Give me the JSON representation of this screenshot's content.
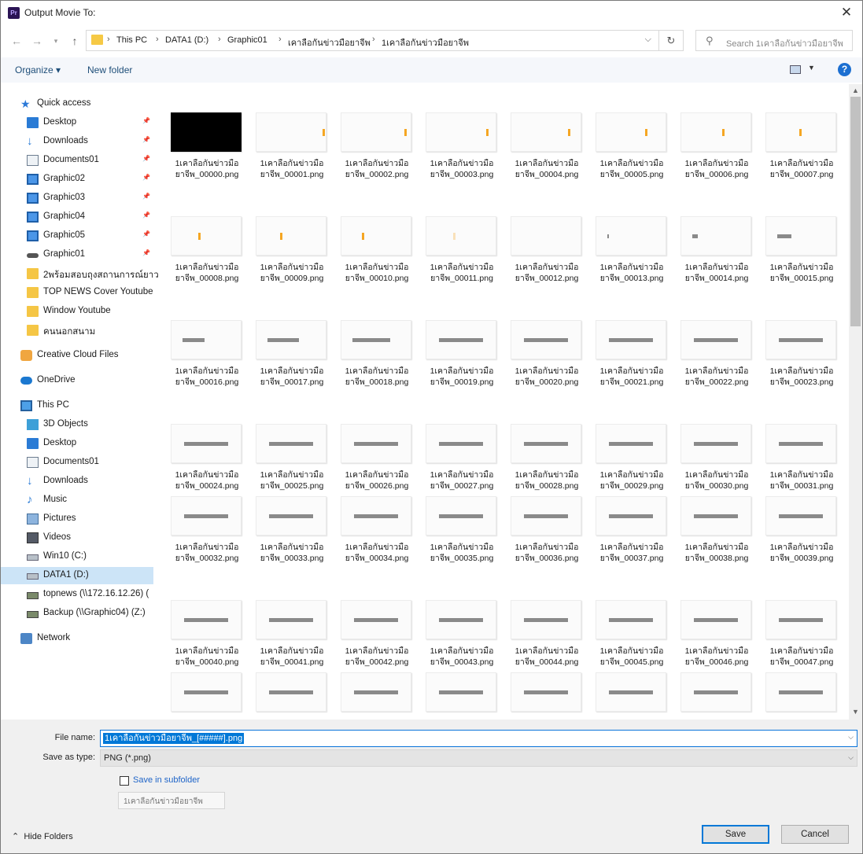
{
  "window": {
    "title": "Output Movie To:",
    "app_icon_text": "Pr"
  },
  "address": {
    "crumbs": [
      "This PC",
      "DATA1 (D:)",
      "Graphic01",
      "เคาลือกันข่าวมือยาจีพ",
      "1เคาลือกันข่าวมือยาจีพ"
    ],
    "search_placeholder": "Search 1เคาลือกันข่าวมือยาจีพ"
  },
  "toolbar": {
    "organize_label": "Organize ▾",
    "new_folder_label": "New folder"
  },
  "sidebar": {
    "items": [
      {
        "label": "Quick access",
        "icon": "star-icon",
        "indent": 0,
        "pinned": false
      },
      {
        "label": "Desktop",
        "icon": "desktop-icon",
        "indent": 1,
        "pinned": true
      },
      {
        "label": "Downloads",
        "icon": "download-icon",
        "indent": 1,
        "pinned": true
      },
      {
        "label": "Documents01",
        "icon": "document-icon",
        "indent": 1,
        "pinned": true
      },
      {
        "label": "Graphic02",
        "icon": "monitor-icon",
        "indent": 1,
        "pinned": true
      },
      {
        "label": "Graphic03",
        "icon": "monitor-icon",
        "indent": 1,
        "pinned": true
      },
      {
        "label": "Graphic04",
        "icon": "monitor-icon",
        "indent": 1,
        "pinned": true
      },
      {
        "label": "Graphic05",
        "icon": "monitor-icon",
        "indent": 1,
        "pinned": true
      },
      {
        "label": "Graphic01",
        "icon": "network-drive-icon",
        "indent": 1,
        "pinned": true
      },
      {
        "label": "2พร้อมสอบถุงสถานการณ์ยาว",
        "icon": "folder-icon",
        "indent": 1,
        "pinned": false
      },
      {
        "label": "TOP NEWS Cover Youtube",
        "icon": "folder-icon",
        "indent": 1,
        "pinned": false
      },
      {
        "label": "Window Youtube",
        "icon": "folder-icon",
        "indent": 1,
        "pinned": false
      },
      {
        "label": "คนนอกสนาม",
        "icon": "folder-icon",
        "indent": 1,
        "pinned": false
      },
      {
        "label": "Creative Cloud Files",
        "icon": "creative-cloud-icon",
        "indent": 0,
        "pinned": false
      },
      {
        "label": "OneDrive",
        "icon": "onedrive-icon",
        "indent": 0,
        "pinned": false
      },
      {
        "label": "This PC",
        "icon": "pc-icon",
        "indent": 0,
        "pinned": false
      },
      {
        "label": "3D Objects",
        "icon": "3d-objects-icon",
        "indent": 1,
        "pinned": false
      },
      {
        "label": "Desktop",
        "icon": "desktop-icon",
        "indent": 1,
        "pinned": false
      },
      {
        "label": "Documents01",
        "icon": "document-icon",
        "indent": 1,
        "pinned": false
      },
      {
        "label": "Downloads",
        "icon": "download-icon",
        "indent": 1,
        "pinned": false
      },
      {
        "label": "Music",
        "icon": "music-icon",
        "indent": 1,
        "pinned": false
      },
      {
        "label": "Pictures",
        "icon": "pictures-icon",
        "indent": 1,
        "pinned": false
      },
      {
        "label": "Videos",
        "icon": "videos-icon",
        "indent": 1,
        "pinned": false
      },
      {
        "label": "Win10 (C:)",
        "icon": "drive-icon",
        "indent": 1,
        "pinned": false
      },
      {
        "label": "DATA1 (D:)",
        "icon": "drive-icon",
        "indent": 1,
        "pinned": false,
        "selected": true
      },
      {
        "label": "topnews (\\\\172.16.12.26) (",
        "icon": "network-drive-icon",
        "indent": 1,
        "pinned": false
      },
      {
        "label": "Backup (\\\\Graphic04) (Z:)",
        "icon": "network-drive-icon",
        "indent": 1,
        "pinned": false
      },
      {
        "label": "Network",
        "icon": "network-icon",
        "indent": 0,
        "pinned": false
      }
    ]
  },
  "files": {
    "name_prefix_line1": "1เคาลือกันข่าวมือ",
    "name_prefix_line2": "ยาจีพ_",
    "extension": ".png",
    "items": [
      {
        "num": "00000",
        "thumb": "black"
      },
      {
        "num": "00001",
        "thumb": "orange"
      },
      {
        "num": "00002",
        "thumb": "orange"
      },
      {
        "num": "00003",
        "thumb": "orange"
      },
      {
        "num": "00004",
        "thumb": "orange"
      },
      {
        "num": "00005",
        "thumb": "orange"
      },
      {
        "num": "00006",
        "thumb": "orange"
      },
      {
        "num": "00007",
        "thumb": "orange"
      },
      {
        "num": "00008",
        "thumb": "orange"
      },
      {
        "num": "00009",
        "thumb": "orange"
      },
      {
        "num": "00010",
        "thumb": "orange"
      },
      {
        "num": "00011",
        "thumb": "faint"
      },
      {
        "num": "00012",
        "thumb": "blank"
      },
      {
        "num": "00013",
        "thumb": "gray-1"
      },
      {
        "num": "00014",
        "thumb": "gray-2"
      },
      {
        "num": "00015",
        "thumb": "gray-3"
      },
      {
        "num": "00016",
        "thumb": "gray-4"
      },
      {
        "num": "00017",
        "thumb": "gray-5"
      },
      {
        "num": "00018",
        "thumb": "gray-6"
      },
      {
        "num": "00019",
        "thumb": "gray-7"
      },
      {
        "num": "00020",
        "thumb": "gray-7"
      },
      {
        "num": "00021",
        "thumb": "gray-7"
      },
      {
        "num": "00022",
        "thumb": "gray-7"
      },
      {
        "num": "00023",
        "thumb": "gray-7"
      },
      {
        "num": "00024",
        "thumb": "gray-7"
      },
      {
        "num": "00025",
        "thumb": "gray-7"
      },
      {
        "num": "00026",
        "thumb": "gray-7"
      },
      {
        "num": "00027",
        "thumb": "gray-7"
      },
      {
        "num": "00028",
        "thumb": "gray-7"
      },
      {
        "num": "00029",
        "thumb": "gray-7"
      },
      {
        "num": "00030",
        "thumb": "gray-7"
      },
      {
        "num": "00031",
        "thumb": "gray-7"
      },
      {
        "num": "00032",
        "thumb": "gray-7"
      },
      {
        "num": "00033",
        "thumb": "gray-7"
      },
      {
        "num": "00034",
        "thumb": "gray-7"
      },
      {
        "num": "00035",
        "thumb": "gray-7"
      },
      {
        "num": "00036",
        "thumb": "gray-7"
      },
      {
        "num": "00037",
        "thumb": "gray-7"
      },
      {
        "num": "00038",
        "thumb": "gray-7"
      },
      {
        "num": "00039",
        "thumb": "gray-7"
      },
      {
        "num": "00040",
        "thumb": "gray-7"
      },
      {
        "num": "00041",
        "thumb": "gray-7"
      },
      {
        "num": "00042",
        "thumb": "gray-7"
      },
      {
        "num": "00043",
        "thumb": "gray-7"
      },
      {
        "num": "00044",
        "thumb": "gray-7"
      },
      {
        "num": "00045",
        "thumb": "gray-7"
      },
      {
        "num": "00046",
        "thumb": "gray-7"
      },
      {
        "num": "00047",
        "thumb": "gray-7"
      },
      {
        "num": "",
        "thumb": "gray-7"
      },
      {
        "num": "",
        "thumb": "gray-7"
      },
      {
        "num": "",
        "thumb": "gray-7"
      },
      {
        "num": "",
        "thumb": "gray-7"
      },
      {
        "num": "",
        "thumb": "gray-7"
      },
      {
        "num": "",
        "thumb": "gray-7"
      },
      {
        "num": "",
        "thumb": "gray-7"
      },
      {
        "num": "",
        "thumb": "gray-7"
      }
    ]
  },
  "form": {
    "file_name_label": "File name:",
    "file_name_value": "1เคาลือกันข่าวมือยาจีพ_[#####].png",
    "save_type_label": "Save as type:",
    "save_type_value": "PNG (*.png)",
    "subfolder_label": "Save in subfolder",
    "subfolder_value": "1เคาลือกันข่าวมือยาจีพ",
    "subfolder_checked": false
  },
  "footer": {
    "hide_folders_label": "Hide Folders",
    "save_label": "Save",
    "cancel_label": "Cancel"
  },
  "colors": {
    "accent": "#0078d7",
    "selected_row": "#cce4f7",
    "orange_mark": "#f5a623"
  }
}
